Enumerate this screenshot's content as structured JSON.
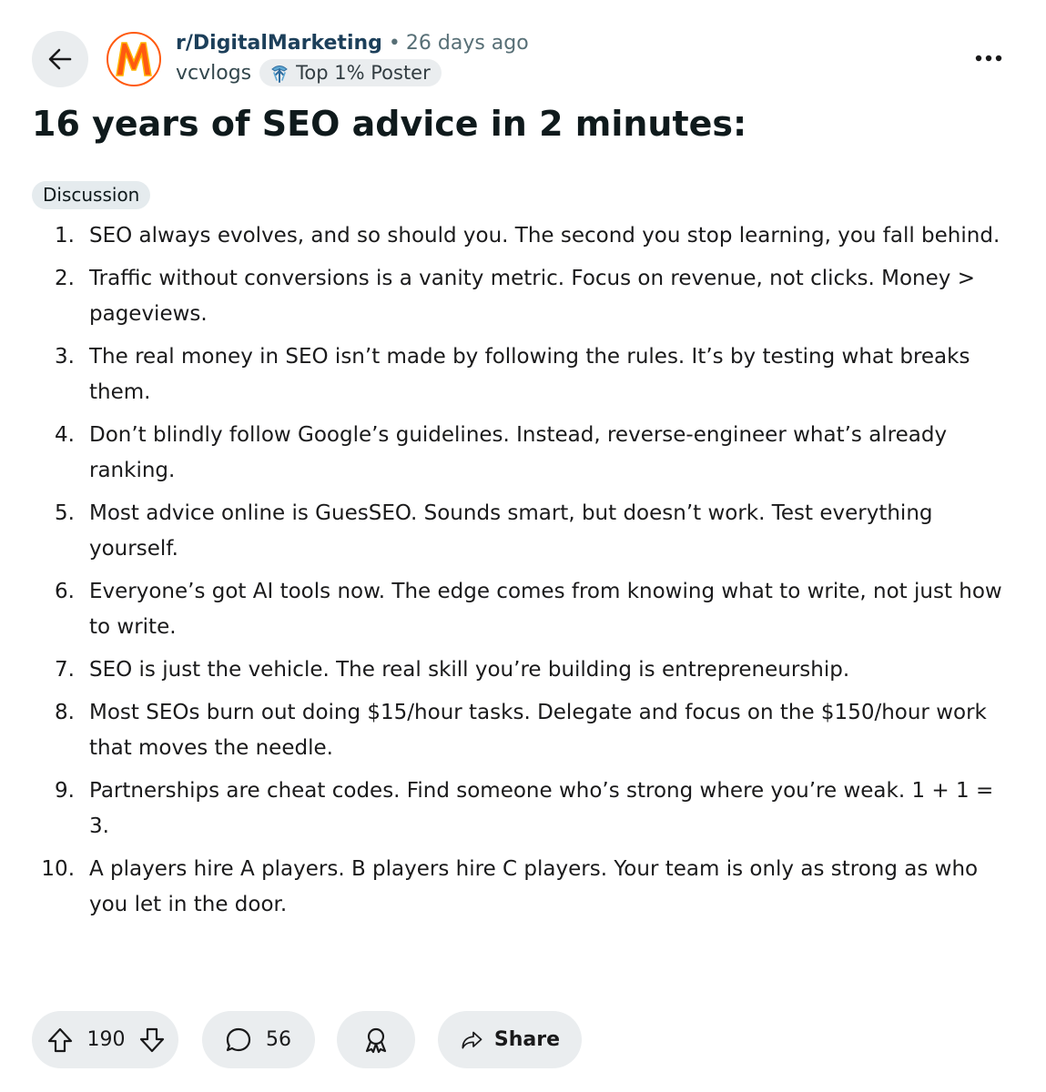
{
  "post": {
    "subreddit": "r/DigitalMarketing",
    "separator": "•",
    "time": "26 days ago",
    "author": "vcvlogs",
    "author_badge": "Top 1% Poster",
    "title": "16 years of SEO advice in 2 minutes:",
    "flair": "Discussion",
    "items": [
      {
        "num": "1.",
        "text": "SEO always evolves, and so should you. The second you stop learning, you fall behind."
      },
      {
        "num": "2.",
        "text": "Traffic without conversions is a vanity metric. Focus on revenue, not clicks. Money > pageviews."
      },
      {
        "num": "3.",
        "text": "The real money in SEO isn’t made by following the rules. It’s by testing what breaks them."
      },
      {
        "num": "4.",
        "text": "Don’t blindly follow Google’s guidelines. Instead, reverse-engineer what’s already ranking."
      },
      {
        "num": "5.",
        "text": "Most advice online is GuesSEO. Sounds smart, but doesn’t work. Test everything yourself."
      },
      {
        "num": "6.",
        "text": "Everyone’s got AI tools now. The edge comes from knowing what to write, not just how to write."
      },
      {
        "num": "7.",
        "text": "SEO is just the vehicle. The real skill you’re building is entrepreneurship."
      },
      {
        "num": "8.",
        "text": "Most SEOs burn out doing $15/hour tasks. Delegate and focus on the $150/hour work that moves the needle."
      },
      {
        "num": "9.",
        "text": "Partnerships are cheat codes. Find someone who’s strong where you’re weak. 1 + 1 = 3."
      },
      {
        "num": "10.",
        "text": "A players hire A players. B players hire C players. Your team is only as strong as who you let in the door."
      }
    ]
  },
  "actions": {
    "upvotes": "190",
    "comments": "56",
    "share_label": "Share"
  },
  "icons": {
    "back": "arrow-left-icon",
    "avatar": "subreddit-logo-m",
    "badge": "top-poster-icon",
    "more": "more-horizontal-icon",
    "upvote": "upvote-arrow-icon",
    "downvote": "downvote-arrow-icon",
    "comment": "comment-bubble-icon",
    "award": "award-icon",
    "share": "share-arrow-icon"
  },
  "colors": {
    "accent": "#ff5a10",
    "pill_bg": "#eaedef",
    "subreddit_text": "#1c3f5a",
    "meta_text": "#576f76"
  }
}
